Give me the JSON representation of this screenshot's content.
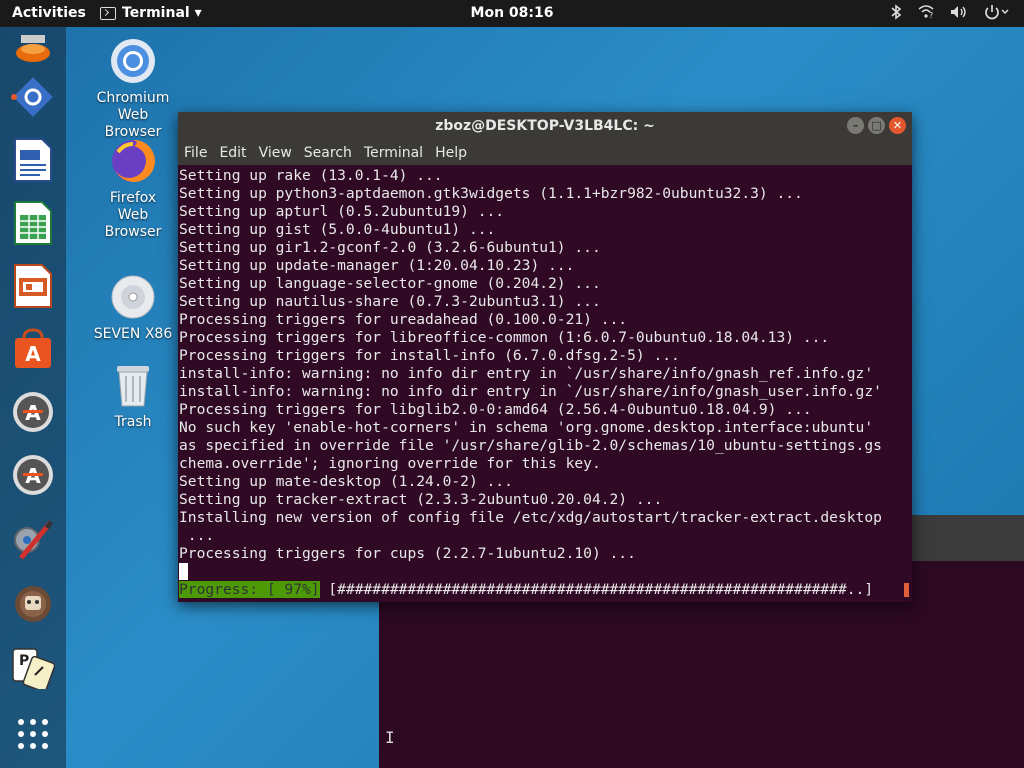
{
  "topbar": {
    "activities": "Activities",
    "app_menu": "Terminal ▾",
    "clock": "Mon 08:16",
    "tray_icons": [
      "bluetooth-icon",
      "network-icon",
      "volume-icon",
      "power-icon"
    ]
  },
  "dock": {
    "items": [
      "vlc-icon",
      "app-installer-icon",
      "libreoffice-writer-icon",
      "libreoffice-calc-icon",
      "libreoffice-impress-icon",
      "ubuntu-software-icon",
      "software-updater-icon",
      "software-updater-2-icon",
      "settings-tools-icon",
      "app-icon",
      "solitaire-icon",
      "show-applications-icon"
    ]
  },
  "desktop": {
    "icons": [
      {
        "label": "Chromium\nWeb\nBrowser"
      },
      {
        "label": "Firefox\nWeb\nBrowser"
      },
      {
        "label": "SEVEN X86"
      },
      {
        "label": "Trash"
      }
    ]
  },
  "terminal": {
    "title": "zboz@DESKTOP-V3LB4LC: ~",
    "menu": [
      "File",
      "Edit",
      "View",
      "Search",
      "Terminal",
      "Help"
    ],
    "lines": [
      "Setting up rake (13.0.1-4) ...",
      "Setting up python3-aptdaemon.gtk3widgets (1.1.1+bzr982-0ubuntu32.3) ...",
      "Setting up apturl (0.5.2ubuntu19) ...",
      "Setting up gist (5.0.0-4ubuntu1) ...",
      "Setting up gir1.2-gconf-2.0 (3.2.6-6ubuntu1) ...",
      "Setting up update-manager (1:20.04.10.23) ...",
      "Setting up language-selector-gnome (0.204.2) ...",
      "Setting up nautilus-share (0.7.3-2ubuntu3.1) ...",
      "Processing triggers for ureadahead (0.100.0-21) ...",
      "Processing triggers for libreoffice-common (1:6.0.7-0ubuntu0.18.04.13) ...",
      "Processing triggers for install-info (6.7.0.dfsg.2-5) ...",
      "install-info: warning: no info dir entry in `/usr/share/info/gnash_ref.info.gz'",
      "install-info: warning: no info dir entry in `/usr/share/info/gnash_user.info.gz'",
      "Processing triggers for libglib2.0-0:amd64 (2.56.4-0ubuntu0.18.04.9) ...",
      "No such key 'enable-hot-corners' in schema 'org.gnome.desktop.interface:ubuntu'",
      "as specified in override file '/usr/share/glib-2.0/schemas/10_ubuntu-settings.gs",
      "chema.override'; ignoring override for this key.",
      "Setting up mate-desktop (1.24.0-2) ...",
      "Setting up tracker-extract (2.3.3-2ubuntu0.20.04.2) ...",
      "Installing new version of config file /etc/xdg/autostart/tracker-extract.desktop",
      " ...",
      "Processing triggers for cups (2.2.7-1ubuntu2.10) ..."
    ],
    "progress_label": "Progress: [ 97%]",
    "progress_percent": 97,
    "progress_bar": " [##########################################################..]"
  }
}
